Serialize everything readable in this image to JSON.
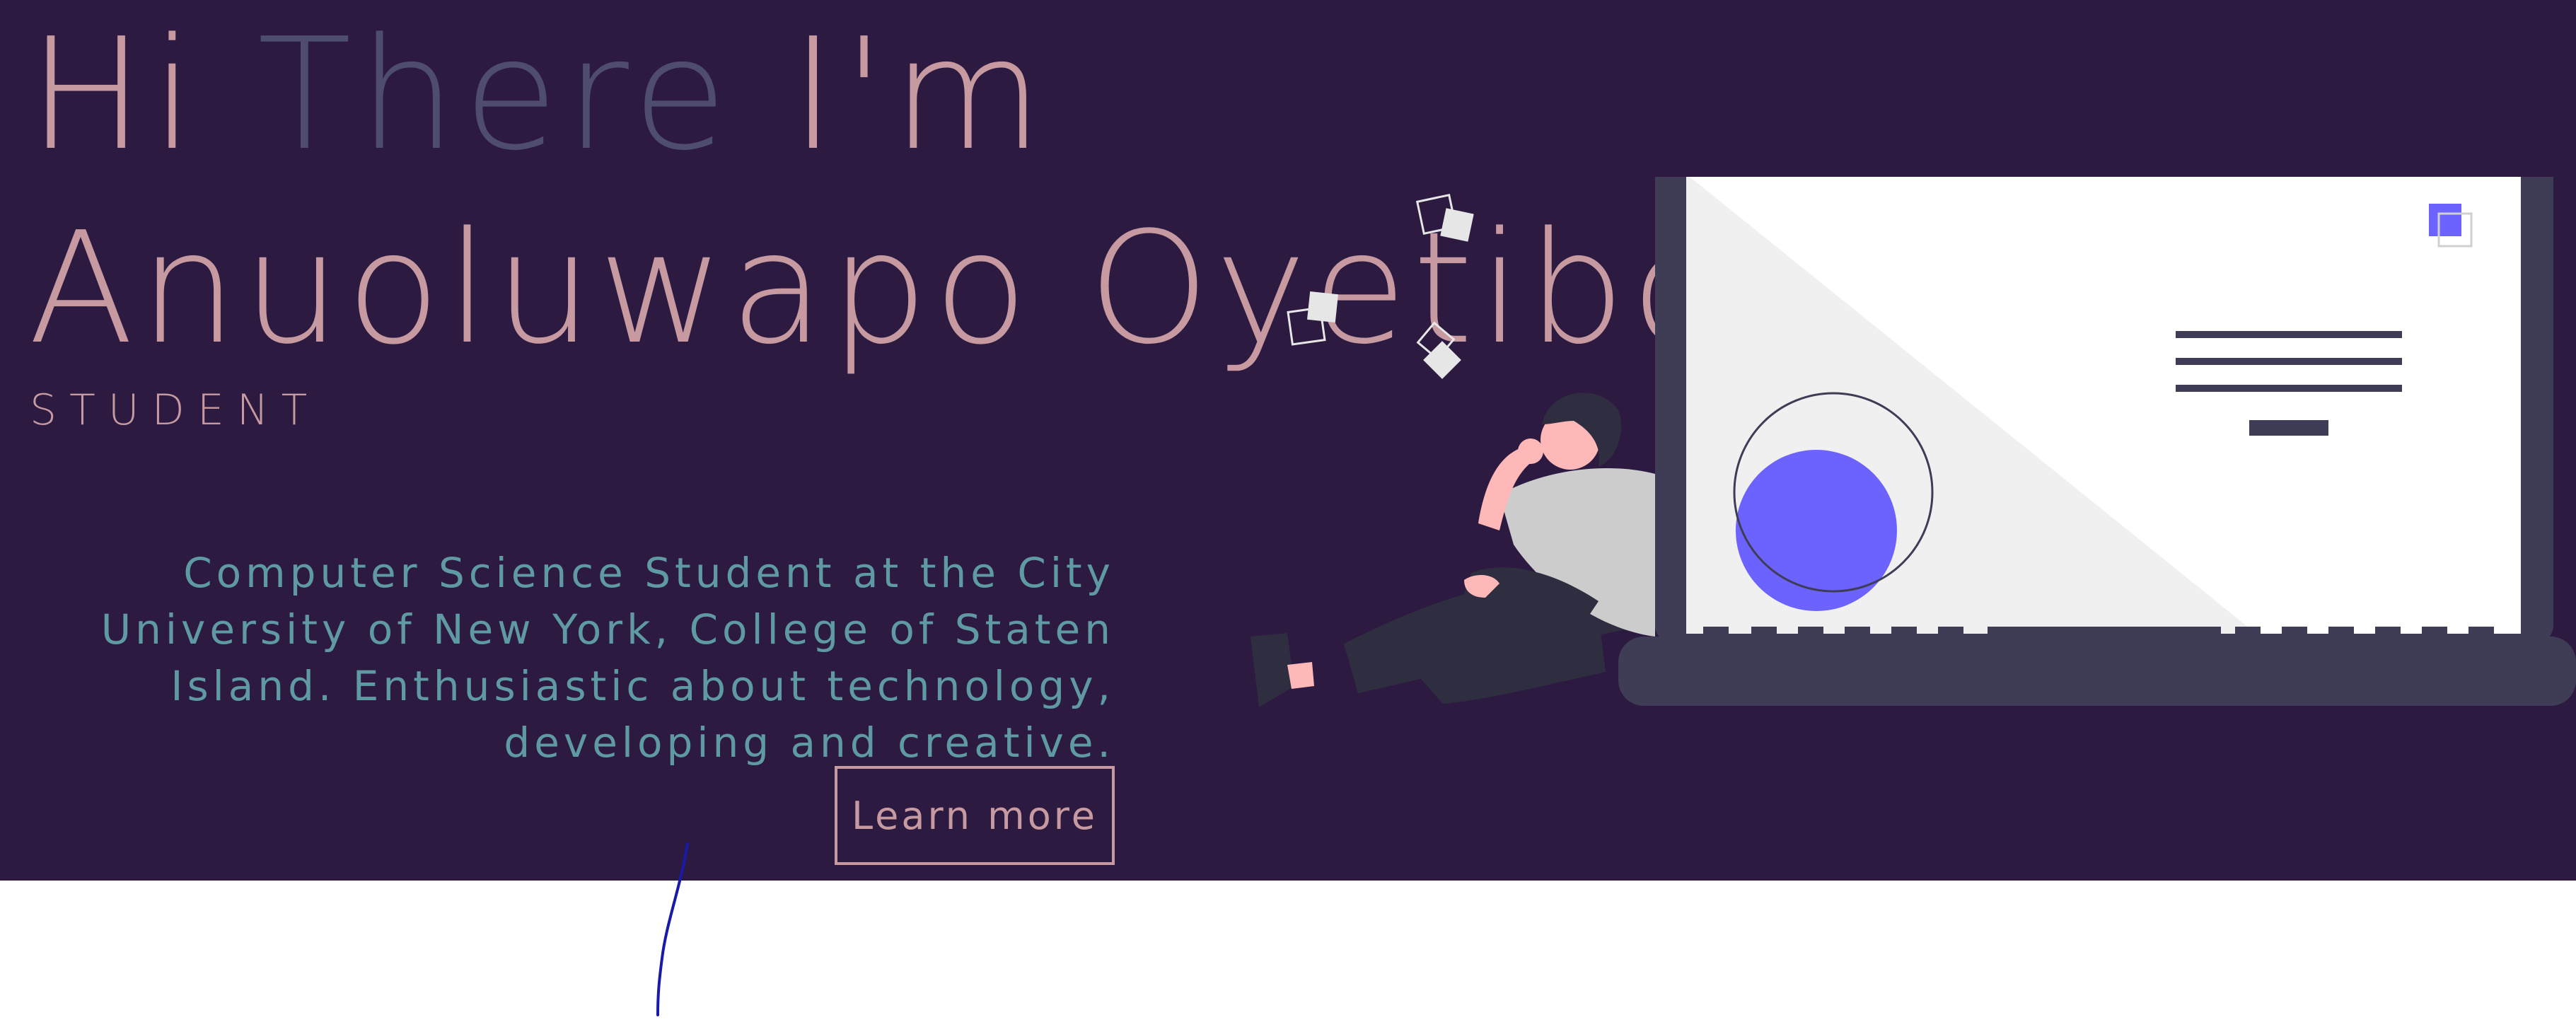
{
  "hero": {
    "greeting": {
      "hi": "Hi ",
      "there": "There",
      "im": " I'm"
    },
    "name": "Anuoluwapo Oyetibo",
    "role": "STUDENT",
    "bio": "Computer Science Student at the City University of New York, College of Staten Island. Enthusiastic about technology, developing and creative.",
    "cta_label": "Learn more"
  },
  "colors": {
    "background": "#2c1a41",
    "accent_pink": "#c69aa0",
    "muted_slate": "#4f4d6f",
    "teal_text": "#5f9aa4",
    "illustration_purple": "#6c63ff",
    "laptop_frame": "#3f3d56"
  },
  "illustration": {
    "icon": "person-leaning-on-laptop-illustration"
  }
}
